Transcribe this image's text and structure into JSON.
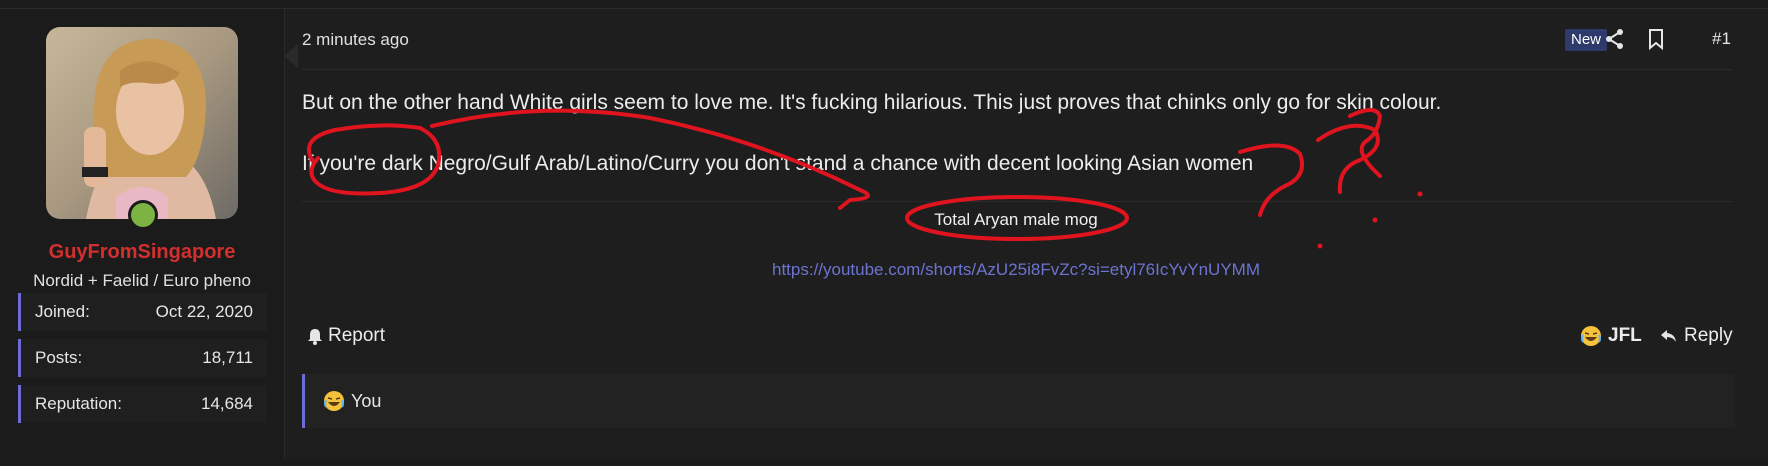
{
  "user": {
    "username": "GuyFromSingapore",
    "title": "Nordid + Faelid / Euro pheno",
    "stats": [
      {
        "label": "Joined:",
        "value": "Oct 22, 2020"
      },
      {
        "label": "Posts:",
        "value": "18,711"
      },
      {
        "label": "Reputation:",
        "value": "14,684"
      }
    ],
    "online_color": "#7cb342",
    "name_color": "#d32f2f"
  },
  "post": {
    "timestamp": "2 minutes ago",
    "badge": "New",
    "number": "#1",
    "paragraphs": [
      "But on the other hand White girls seem to love me. It's fucking hilarious. This just proves that chinks only go for skin colour.",
      "If you're dark Negro/Gulf Arab/Latino/Curry you don't stand a chance with decent looking Asian women"
    ],
    "signature_text": "Total Aryan male mog",
    "signature_link": "https://youtube.com/shorts/AzU25i8FvZc?si=etyl76IcYvYnUYMM"
  },
  "actions": {
    "report": "Report",
    "react": "JFL",
    "reply": "Reply"
  },
  "reactions": {
    "label": "You"
  },
  "icons": {
    "share": "share-icon",
    "bookmark": "bookmark-icon",
    "bell": "bell-icon",
    "reply": "reply-arrow-icon",
    "emoji": "laughing-crying-emoji-icon"
  },
  "colors": {
    "accent": "#6c6cd4",
    "link": "#6c74d0",
    "annotation": "#e0141e"
  }
}
